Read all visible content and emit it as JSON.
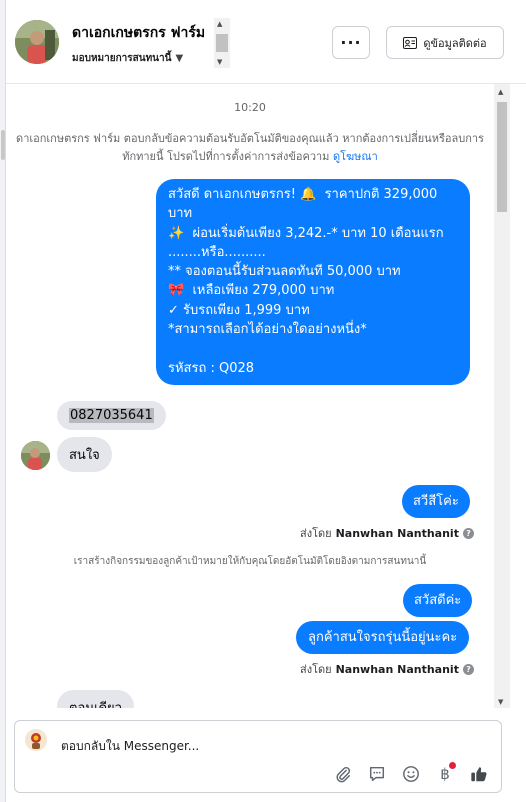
{
  "header": {
    "page_name": "ดาเอกเกษตรกร ฟาร์ม",
    "assign_label": "มอบหมายการสนทนานี้",
    "more_label": "···",
    "contact_label": "ดูข้อมูลติดต่อ"
  },
  "chat": {
    "time": "10:20",
    "system_note": "ดาเอกเกษตรกร ฟาร์ม ตอบกลับข้อความต้อนรับอัตโนมัติของคุณแล้ว หากต้องการเปลี่ยนหรือลบการทักทายนี้ โปรดไปที่การตั้งค่าการส่งข้อความ",
    "system_note_link": "ดูโฆษณา",
    "promo_message": "สวัสดี ดาเอกเกษตรกร! 🔔  ราคาปกติ 329,000 บาท\n✨  ผ่อนเริ่มต้นเพียง 3,242.-* บาท 10 เดือนแรก\n........หรือ..........\n** จองตอนนี้รับส่วนลดทันที 50,000 บาท\n🎀  เหลือเพียง 279,000 บาท\n✓ รับรถเพียง 1,999 บาท\n*สามารถเลือกได้อย่างใดอย่างหนึ่ง*\n\nรหัสรถ : Q028",
    "phone_message": "0827035641",
    "customer_reply": "สนใจ",
    "greeting_1": "สวีสีโค่ะ",
    "sent_by_prefix": "ส่งโดย",
    "sent_by_name": "Nanwhan Nanthanit",
    "activity_note": "เราสร้างกิจกรรมของลูกค้าเป้าหมายให้กับคุณโดยอัตโนมัติโดยอิงตามการสนทนานี้",
    "greeting_2": "สวัสดีค่ะ",
    "ask_message": "ลูกค้าสนใจรถรุ่นนี้อยู่นะคะ",
    "partial_message": "ตอนเดียว"
  },
  "composer": {
    "placeholder": "ตอบกลับใน Messenger...",
    "tools": [
      "attach-icon",
      "quick-reply-icon",
      "emoji-icon",
      "baht-icon",
      "like-icon"
    ]
  },
  "colors": {
    "outgoing_bubble": "#0a7cff",
    "incoming_bubble": "#e4e6eb",
    "link": "#1877f2"
  }
}
